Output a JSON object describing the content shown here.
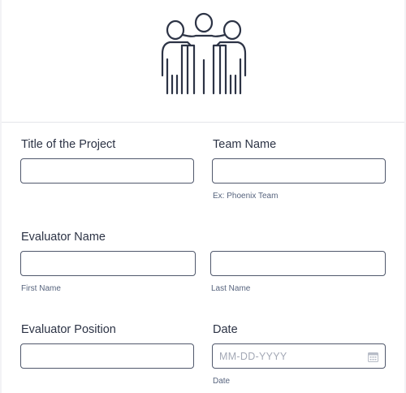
{
  "fields": {
    "project_title": {
      "label": "Title of the Project",
      "value": ""
    },
    "team_name": {
      "label": "Team Name",
      "value": "",
      "sublabel": "Ex: Phoenix Team"
    },
    "evaluator_name": {
      "label": "Evaluator Name",
      "first": {
        "value": "",
        "sublabel": "First Name"
      },
      "last": {
        "value": "",
        "sublabel": "Last Name"
      }
    },
    "evaluator_position": {
      "label": "Evaluator Position",
      "value": ""
    },
    "date": {
      "label": "Date",
      "placeholder": "MM-DD-YYYY",
      "sublabel": "Date",
      "icon": "calendar-icon"
    }
  },
  "header": {
    "icon": "team-group-icon"
  },
  "colors": {
    "border": "#50586c",
    "text": "#2c3345",
    "sublabel": "#57647e",
    "placeholder": "#a4a9b6"
  }
}
